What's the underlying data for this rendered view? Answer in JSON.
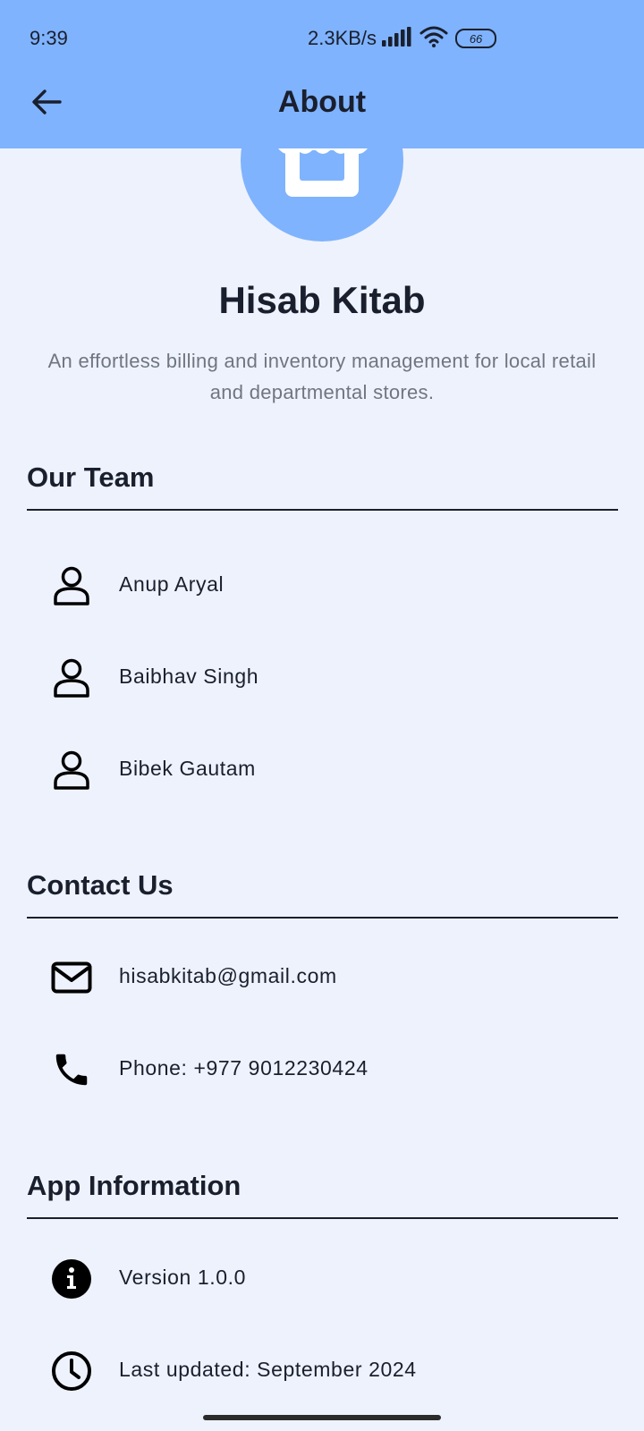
{
  "status_bar": {
    "time": "9:39",
    "speed": "2.3KB/s",
    "battery": "66",
    "icons": [
      "signal-icon",
      "wifi-icon",
      "battery-icon"
    ]
  },
  "app_bar": {
    "title": "About",
    "back_icon": "arrow-back-icon",
    "background": "#7fb3fd"
  },
  "header": {
    "logo_icon": "storefront-icon",
    "app_name": "Hisab Kitab",
    "description": "An effortless billing and inventory management for local retail and departmental stores."
  },
  "team": {
    "title": "Our Team",
    "members": [
      {
        "name": "Anup Aryal",
        "icon": "person-icon"
      },
      {
        "name": "Baibhav Singh",
        "icon": "person-icon"
      },
      {
        "name": "Bibek Gautam",
        "icon": "person-icon"
      }
    ]
  },
  "contact": {
    "title": "Contact Us",
    "items": [
      {
        "text": "hisabkitab@gmail.com",
        "icon": "email-icon"
      },
      {
        "text": "Phone: +977 9012230424",
        "icon": "phone-icon"
      }
    ]
  },
  "app_info": {
    "title": "App Information",
    "items": [
      {
        "text": "Version 1.0.0",
        "icon": "info-icon"
      },
      {
        "text": "Last updated: September 2024",
        "icon": "clock-icon"
      }
    ]
  },
  "colors": {
    "accent": "#7fb3fd",
    "background": "#eef2fd",
    "text": "#1a1f2e",
    "muted_text": "#707681"
  }
}
